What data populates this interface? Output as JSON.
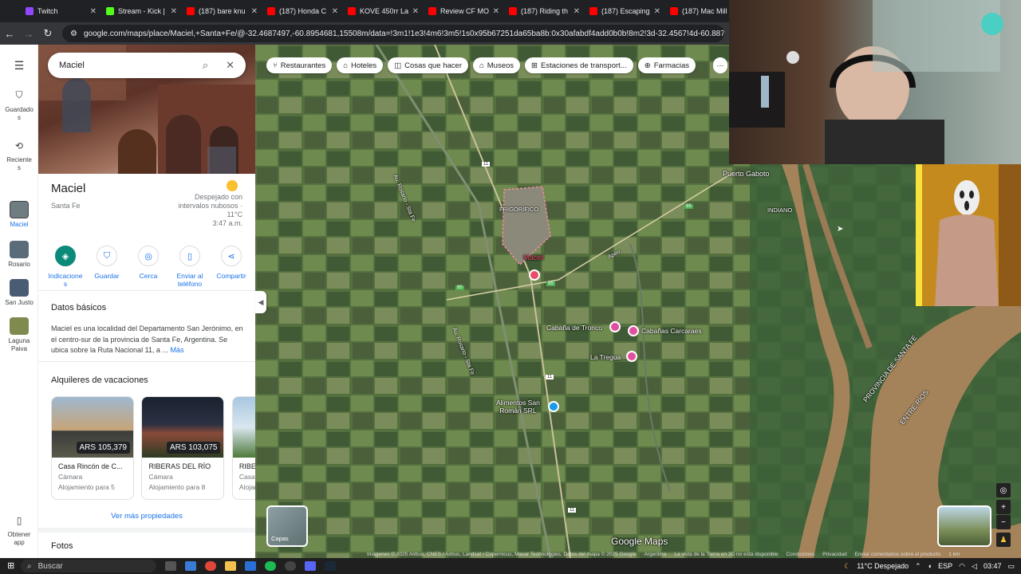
{
  "browser": {
    "tabs": [
      {
        "title": "Twitch",
        "color": "#9146ff"
      },
      {
        "title": "Stream - Kick |",
        "color": "#53fc18"
      },
      {
        "title": "(187) bare knu",
        "color": "#ff0000"
      },
      {
        "title": "(187) Honda C",
        "color": "#ff0000"
      },
      {
        "title": "KOVE 450rr La",
        "color": "#ff0000"
      },
      {
        "title": "Review CF MO",
        "color": "#ff0000"
      },
      {
        "title": "(187) Riding th",
        "color": "#ff0000"
      },
      {
        "title": "(187) Escaping",
        "color": "#ff0000"
      },
      {
        "title": "(187) Mac Mill",
        "color": "#ff0000"
      }
    ],
    "url": "google.com/maps/place/Maciel,+Santa+Fe/@-32.4687497,-60.8954681,15508m/data=!3m1!1e3!4m6!3m5!1s0x95b67251da65ba8b:0x30afabdf4add0b0b!8m2!3d-32.4567!4d-60.8876992!16s%2Fg"
  },
  "rail": {
    "menu_icon": "menu-icon",
    "items": [
      {
        "label": "Guardado\ns",
        "icon": "bookmark-icon"
      },
      {
        "label": "Reciente\ns",
        "icon": "history-icon"
      },
      {
        "label": "Maciel",
        "icon": "place-thumb"
      },
      {
        "label": "Rosario",
        "icon": "place-thumb"
      },
      {
        "label": "San Justo",
        "icon": "place-thumb"
      },
      {
        "label": "Laguna\nPaiva",
        "icon": "place-thumb"
      },
      {
        "label": "Obtener\napp",
        "icon": "phone-icon"
      }
    ]
  },
  "search": {
    "query": "Maciel"
  },
  "place": {
    "name": "Maciel",
    "region": "Santa Fe",
    "weather": {
      "desc": "Despejado con intervalos nubosos ·",
      "temp": "11°C",
      "time": "3:47 a.m."
    },
    "actions": [
      "Indicacione\ns",
      "Guardar",
      "Cerca",
      "Enviar al teléfono",
      "Compartir"
    ],
    "basics_title": "Datos básicos",
    "description": "Maciel es una localidad del Departamento San Jerónimo, en el centro-sur de la provincia de Santa Fe, Argentina. Se ubica sobre la Ruta Nacional 11, a ...",
    "more": "Más",
    "rentals_title": "Alquileres de vacaciones",
    "rentals": [
      {
        "price": "ARS 105,379",
        "name": "Casa Rincón de C...",
        "type": "Cámara",
        "guests": "Alojamiento para 5"
      },
      {
        "price": "ARS 103,075",
        "name": "RIBERAS DEL RÍO",
        "type": "Cámara",
        "guests": "Alojamiento para 8"
      },
      {
        "price": "A",
        "name": "RIBERA",
        "type": "Casa d",
        "guests": "Alojam"
      }
    ],
    "more_props": "Ver más propiedades",
    "photos_title": "Fotos"
  },
  "chips": [
    "Restaurantes",
    "Hoteles",
    "Cosas que hacer",
    "Museos",
    "Estaciones de transport...",
    "Farmacias"
  ],
  "map": {
    "labels": {
      "puerto_gaboto": "Puerto Gaboto",
      "frigorifico": "FRIGORÍFICO",
      "indiano": "INDIANO",
      "maciel": "Maciel",
      "cabana_tronco": "Cabaña de Tronco",
      "cabanas_carcaraes": "Cabañas Carcaraes",
      "la_tregua": "La Tregua",
      "alimentos": "Alimentos San\nRomán SRL",
      "provincia": "PROVINCIA DE SANTA FE",
      "entre_rios": "ENTRE RÍOS",
      "ruta_11": "11",
      "ruta_95": "95",
      "au_rosario": "Au. Rosario - Sta Fe",
      "apeo": "Apeo",
      "google_maps": "Google Maps",
      "layers": "Capas"
    },
    "footer": [
      "Imágenes © 2025 Airbus, CNES / Airbus, Landsat / Copernicus, Maxar Technologies, Datos del mapa © 2025 Google",
      "Argentina",
      "La vista de la Tierra en 3D no está disponible",
      "Condiciones",
      "Privacidad",
      "Enviar comentarios sobre el producto",
      "1 km"
    ]
  },
  "taskbar": {
    "search": "Buscar",
    "weather": "11°C  Despejado",
    "lang": "ESP",
    "time": "03:47"
  }
}
